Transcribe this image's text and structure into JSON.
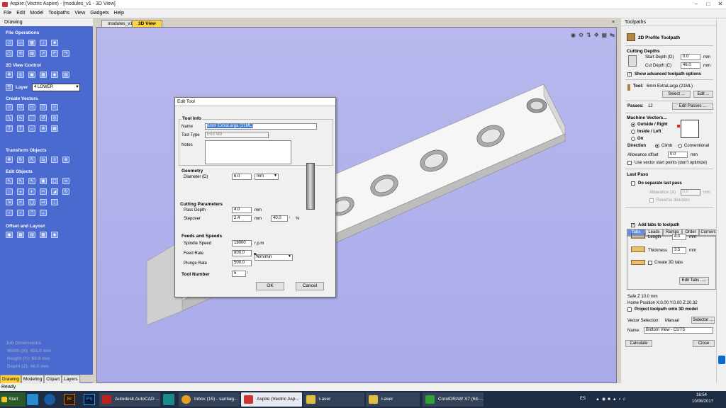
{
  "app": {
    "title": "Aspire (Vectric Aspire) - [modules_v1 - 3D View]"
  },
  "menu": [
    "File",
    "Edit",
    "Model",
    "Toolpaths",
    "View",
    "Gadgets",
    "Help"
  ],
  "left": {
    "header": "Drawing",
    "file_ops": "File Operations",
    "view_control": "2D View Control",
    "layer_label": "Layer",
    "layer_value": "4 LOWER",
    "create_vectors": "Create Vectors",
    "transform_objects": "Transform Objects",
    "edit_objects": "Edit Objects",
    "offset_layout": "Offset and Layout",
    "job_dimensions": {
      "title": "Job Dimensions",
      "width": "Width  (X): 451.0 mm",
      "height": "Height (Y): 60.8 mm",
      "depth": "Depth  (Z): 46.0 mm"
    },
    "tabs": [
      "Drawing",
      "Modeling",
      "Clipart",
      "Layers"
    ]
  },
  "view": {
    "tabs": [
      "modules_v1",
      "3D View"
    ]
  },
  "dialog": {
    "title": "Edit Tool",
    "tool_info": "Tool Info",
    "name_label": "Name",
    "name_value": "6mm ExtraLarga (21ML)",
    "tool_type_label": "Tool Type",
    "tool_type_value": "End Mill",
    "notes_label": "Notes",
    "geometry": "Geometry",
    "diameter_label": "Diameter (D)",
    "diameter_value": "6.0",
    "diameter_unit": "mm",
    "cutting_params": "Cutting Parameters",
    "pass_depth_label": "Pass Depth",
    "pass_depth_value": "4.0",
    "pass_depth_unit": "mm",
    "stepover_label": "Stepover",
    "stepover_value": "2.4",
    "stepover_unit": "mm",
    "stepover_pct": "40.0",
    "pct": "%",
    "feeds": "Feeds and Speeds",
    "spindle_label": "Spindle Speed",
    "spindle_value": "18000",
    "spindle_unit": "r.p.m",
    "feed_label": "Feed Rate",
    "feed_value": "800.0",
    "feed_unit": "mm/min",
    "plunge_label": "Plunge Rate",
    "plunge_value": "500.0",
    "tool_number_label": "Tool Number",
    "tool_number_value": "5",
    "ok": "OK",
    "cancel": "Cancel"
  },
  "right": {
    "header": "Toolpaths",
    "title": "2D Profile Toolpath",
    "cutting_depths": "Cutting Depths",
    "start_depth_label": "Start Depth (D)",
    "start_depth_value": "0.0",
    "start_depth_unit": "mm",
    "cut_depth_label": "Cut Depth (C)",
    "cut_depth_value": "46.0",
    "cut_depth_unit": "mm",
    "show_advanced": "Show advanced toolpath options",
    "tool_label": "Tool:",
    "tool_value": "6mm ExtraLarga (21ML)",
    "select_btn": "Select ...",
    "edit_btn": "Edit ...",
    "passes_label": "Passes:",
    "passes_value": "12",
    "edit_passes_btn": "Edit Passes ...",
    "machine_vectors": "Machine Vectors...",
    "outside_right": "Outside / Right",
    "inside_left": "Inside / Left",
    "on": "On",
    "direction_label": "Direction",
    "climb": "Climb",
    "conventional": "Conventional",
    "allowance_label": "Allowance offset",
    "allowance_value": "0.0",
    "allowance_unit": "mm",
    "use_vector_start": "Use vector start points (don't optimize)",
    "last_pass": "Last Pass",
    "separate_last_pass": "Do separate last pass",
    "allowance_a_label": "Allowance (A)",
    "allowance_a_value": "0.0",
    "allowance_a_unit": "mm",
    "reverse_direction": "Reverse direction",
    "tabs": [
      "Tabs",
      "Leads",
      "Ramps",
      "Order",
      "Corners"
    ],
    "add_tabs": "Add tabs to toolpath",
    "length_label": "Length",
    "length_value": "4.0",
    "length_unit": "mm",
    "thickness_label": "Thickness",
    "thickness_value": "3.5",
    "thickness_unit": "mm",
    "create_3d_tabs": "Create 3D tabs",
    "edit_tabs_btn": "Edit Tabs .....",
    "safe_z": "Safe Z         10.0 mm",
    "home_position": "Home Position   X:0.00 Y:0.00 Z:20.32",
    "project_3d": "Project toolpath onto 3D model",
    "vector_selection_label": "Vector Selection:",
    "vector_selection_value": "Manual",
    "selector_btn": "Selector ...",
    "name_label": "Name:",
    "name_value": "Bottom View - CUTS",
    "calculate_btn": "Calculate",
    "close_btn": "Close"
  },
  "status": "Ready",
  "taskbar": {
    "start": "Start",
    "items": [
      "Autodesk AutoCAD ...",
      "Inbox (15) - santiag...",
      "Aspire (Vectric Asp...",
      "Laser",
      "Laser",
      "CorelDRAW X7 (64-..."
    ],
    "lang": "ES",
    "time": "16:54",
    "date": "10/06/2017"
  }
}
